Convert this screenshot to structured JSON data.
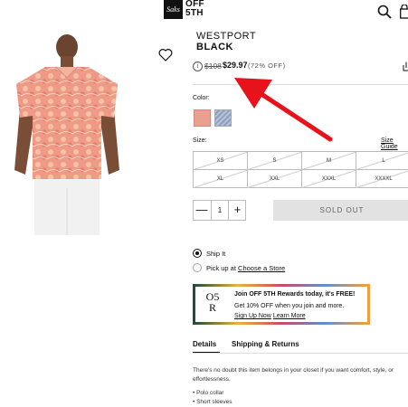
{
  "header": {
    "saks_logo": "Saks",
    "off5th_logo": "OFF 5TH",
    "search_icon": "search-icon",
    "bag_icon": "shopping-bag-icon"
  },
  "product": {
    "brand": "WESTPORT",
    "name": "BLACK",
    "original_price": "$108",
    "sale_price": "$29.97",
    "discount": "(72% OFF)",
    "info_icon": "i"
  },
  "color_section": {
    "label": "Color:",
    "swatches": [
      "coral-floral",
      "blue-pattern"
    ]
  },
  "size_section": {
    "label": "Size:",
    "guide_link": "Size Guide",
    "sizes": [
      "XS",
      "S",
      "M",
      "L",
      "XL",
      "XXL",
      "XXXL",
      "XXXXL"
    ]
  },
  "purchase": {
    "minus": "—",
    "quantity": "1",
    "plus": "+",
    "sold_out": "SOLD OUT"
  },
  "shipping": {
    "ship_it": "Ship It",
    "pick_up_prefix": "Pick up at",
    "choose_store": "Choose a Store",
    "selected": "ship_it"
  },
  "rewards": {
    "logo_line1": "O5",
    "logo_line2": "R",
    "title": "Join OFF 5TH Rewards today, it's FREE!",
    "subtitle": "Get 10% OFF when you join and more.",
    "sign_up": "Sign Up Now",
    "learn_more": "Learn More"
  },
  "tabs": {
    "details": "Details",
    "shipping_returns": "Shipping & Returns",
    "active": "details"
  },
  "description": {
    "text": "There's no doubt this item belongs in your closet if you want comfort, style, or effortlessness.",
    "bullets": [
      "Polo collar",
      "Short sleeves"
    ]
  },
  "colors": {
    "accent_red": "#e8121b",
    "sold_out_bg": "#e2e2e2",
    "shirt_coral": "#e9a08f"
  }
}
